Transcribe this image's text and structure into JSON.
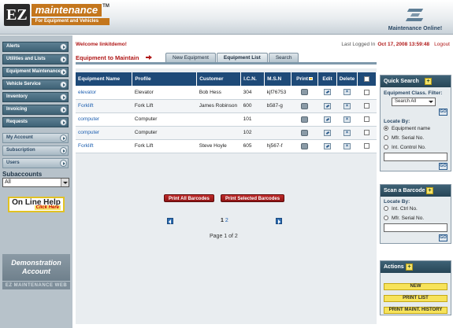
{
  "brand": {
    "logo_ez": "EZ",
    "logo_main": "maintenance",
    "logo_tm": "TM",
    "logo_sub": "For Equipment and Vehicles",
    "right_brand": "Maintenance Online!"
  },
  "sidebar": {
    "items": [
      {
        "label": "Alerts"
      },
      {
        "label": "Utilities and Lists"
      },
      {
        "label": "Equipment Maintenance"
      },
      {
        "label": "Vehicle Service"
      },
      {
        "label": "Inventory"
      },
      {
        "label": "Invoicing"
      },
      {
        "label": "Requests"
      },
      {
        "label": "My Account"
      },
      {
        "label": "Subscription"
      },
      {
        "label": "Users"
      }
    ],
    "subaccounts_label": "Subaccounts",
    "subaccounts_value": "All",
    "help_main": "On Line Help",
    "help_sub": "Click Here",
    "demo_line1": "Demonstration",
    "demo_line2": "Account",
    "footer": "EZ MAINTENANCE WEB"
  },
  "header": {
    "welcome": "Welcome linkitdemo!",
    "last_logged_label": "Last Logged In",
    "last_logged_date": "Oct 17, 2008 13:59:48",
    "logout": "Logout"
  },
  "main": {
    "title": "Equipment to Maintain",
    "tabs": [
      {
        "label": "New Equipment",
        "active": false
      },
      {
        "label": "Equipment List",
        "active": true
      },
      {
        "label": "Search",
        "active": false
      }
    ],
    "columns": [
      "Equipment Name",
      "Profile",
      "Customer",
      "I.C.N.",
      "M.S.N",
      "Print",
      "Edit",
      "Delete"
    ],
    "rows": [
      {
        "name": "elevator",
        "profile": "Elevator",
        "customer": "Bob Hess",
        "icn": "304",
        "msn": "kjf76753"
      },
      {
        "name": "Forklift",
        "profile": "Fork Lift",
        "customer": "James Robinson",
        "icn": "600",
        "msn": "b587-g"
      },
      {
        "name": "computer",
        "profile": "Computer",
        "customer": "",
        "icn": "101",
        "msn": ""
      },
      {
        "name": "computer",
        "profile": "Computer",
        "customer": "",
        "icn": "102",
        "msn": ""
      },
      {
        "name": "Forklift",
        "profile": "Fork Lift",
        "customer": "Steve Hoyle",
        "icn": "605",
        "msn": "hj567-f"
      }
    ],
    "print_all": "Print All Barcodes",
    "print_selected": "Print Selected Barcodes",
    "pager": {
      "current": "1",
      "next": "2",
      "summary": "Page 1 of 2"
    }
  },
  "quick_search": {
    "title": "Quick Search",
    "class_filter_label": "Equipment Class. Filter:",
    "class_filter_value": "Search All",
    "locate_by": "Locate By:",
    "options": [
      "Equipment name",
      "Mfr. Serial No.",
      "Int. Control No."
    ],
    "go": "GO"
  },
  "scan_barcode": {
    "title": "Scan a Barcode",
    "locate_by": "Locate By:",
    "options": [
      "Int. Ctrl No.",
      "Mfr. Serial No."
    ],
    "go": "GO"
  },
  "actions": {
    "title": "Actions",
    "buttons": [
      "NEW",
      "PRINT LIST",
      "PRINT MAINT. HISTORY"
    ]
  }
}
